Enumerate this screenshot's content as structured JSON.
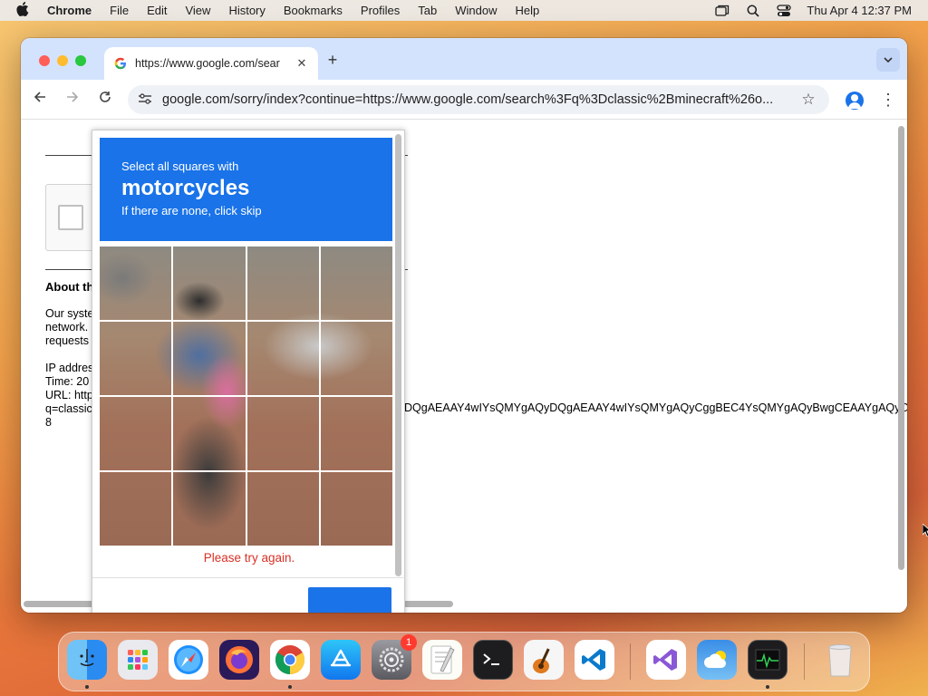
{
  "menubar": {
    "items": [
      "Chrome",
      "File",
      "Edit",
      "View",
      "History",
      "Bookmarks",
      "Profiles",
      "Tab",
      "Window",
      "Help"
    ],
    "clock": "Thu Apr 4  12:37 PM"
  },
  "browser": {
    "tab_title": "https://www.google.com/sear",
    "url": "google.com/sorry/index?continue=https://www.google.com/search%3Fq%3Dclassic%2Bminecraft%26o..."
  },
  "page": {
    "about_heading": "About th",
    "para": [
      "Our syste",
      "network.",
      "requests"
    ],
    "ip_line": "IP addres",
    "time_line": "Time: 20",
    "url_line": "URL: http",
    "q_line": "q=classic",
    "num_line": "8",
    "url_tail": "DQgAEAAY4wIYsQMYgAQyDQgAEAAY4wIYsQMYgAQyCggBEC4YsQMYgAQyBwgCEAAYgAQyCggBEC4YsQMYgAQyBwgCEAAYg"
  },
  "captcha": {
    "line1": "Select all squares with",
    "object": "motorcycles",
    "line3": "If there are none, click skip",
    "error": "Please try again.",
    "accent": "#1a73e8"
  },
  "dock": {
    "apps": [
      {
        "name": "Finder",
        "icon": "finder-icon"
      },
      {
        "name": "Launchpad",
        "icon": "launchpad-icon"
      },
      {
        "name": "Safari",
        "icon": "safari-icon"
      },
      {
        "name": "Firefox",
        "icon": "firefox-icon"
      },
      {
        "name": "Chrome",
        "icon": "chrome-icon"
      },
      {
        "name": "App Store",
        "icon": "appstore-icon"
      },
      {
        "name": "System Settings",
        "icon": "settings-icon",
        "badge": "1"
      },
      {
        "name": "TextEdit",
        "icon": "textedit-icon"
      },
      {
        "name": "Terminal",
        "icon": "terminal-icon"
      },
      {
        "name": "GarageBand",
        "icon": "garageband-icon"
      },
      {
        "name": "VS Code",
        "icon": "vscode-icon"
      },
      {
        "name": "Visual Studio",
        "icon": "visualstudio-icon"
      },
      {
        "name": "Weather",
        "icon": "weather-icon"
      },
      {
        "name": "Activity Monitor",
        "icon": "activitymonitor-icon"
      },
      {
        "name": "Trash",
        "icon": "trash-icon"
      }
    ]
  }
}
